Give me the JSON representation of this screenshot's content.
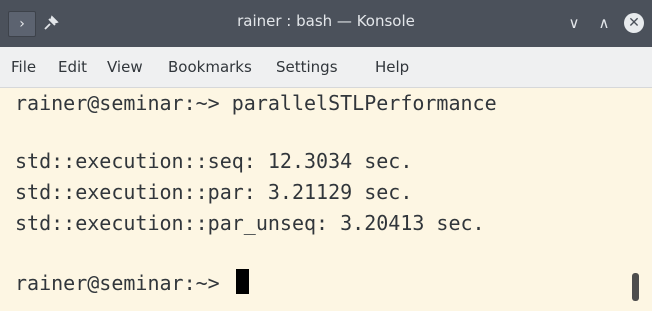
{
  "window": {
    "title": "rainer : bash — Konsole",
    "app_icon_glyph": "›",
    "pin_glyph": "✕",
    "minimize_glyph": "∨",
    "maximize_glyph": "∧",
    "close_glyph": "✕"
  },
  "menubar": {
    "items": [
      "File",
      "Edit",
      "View",
      "Bookmarks",
      "Settings",
      "Help"
    ]
  },
  "terminal": {
    "lines": [
      "rainer@seminar:~> parallelSTLPerformance",
      "",
      "std::execution::seq: 12.3034 sec.",
      "std::execution::par: 3.21129 sec.",
      "std::execution::par_unseq: 3.20413 sec.",
      "",
      "rainer@seminar:~> "
    ],
    "background": "#fdf6e3",
    "foreground": "#31363b"
  }
}
